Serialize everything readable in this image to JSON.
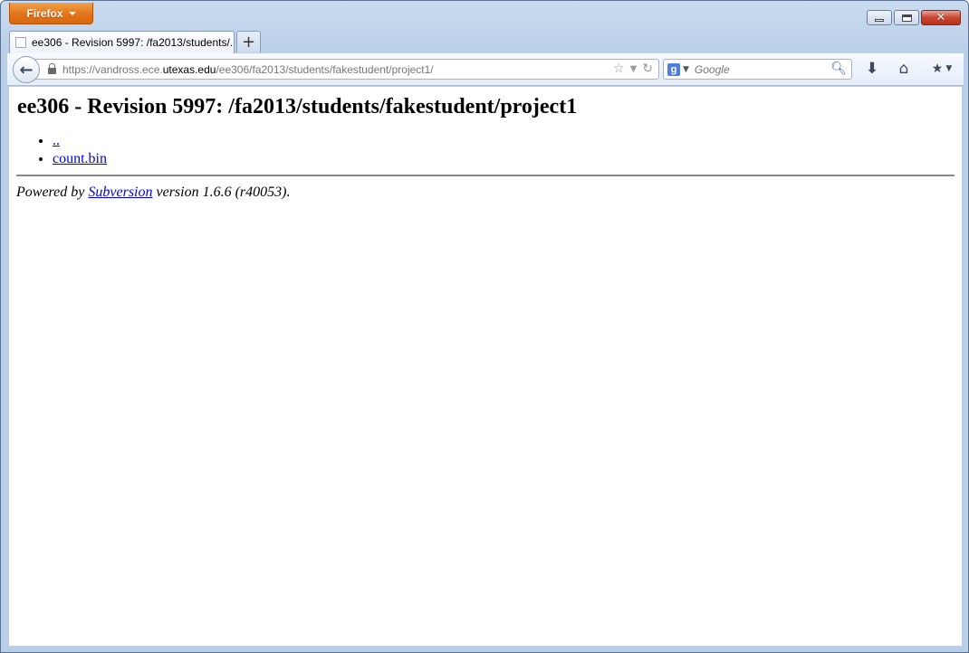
{
  "browser": {
    "app_button_label": "Firefox",
    "tab_title": "ee306 - Revision 5997: /fa2013/students/...",
    "new_tab_label": "+",
    "url_prefix": "https://vandross.ece.",
    "url_domain": "utexas.edu",
    "url_path": "/ee306/fa2013/students/fakestudent/project1/",
    "search_placeholder": "Google",
    "search_engine_icon": "g-icon"
  },
  "page": {
    "heading": "ee306 - Revision 5997: /fa2013/students/fakestudent/project1",
    "links": [
      "..",
      "count.bin"
    ],
    "footer": {
      "prefix": "Powered by ",
      "link": "Subversion",
      "suffix": " version 1.6.6 (r40053)."
    }
  },
  "colors": {
    "app_button": "#e2741a",
    "link": "#0000ee",
    "close_button": "#c7462f"
  }
}
